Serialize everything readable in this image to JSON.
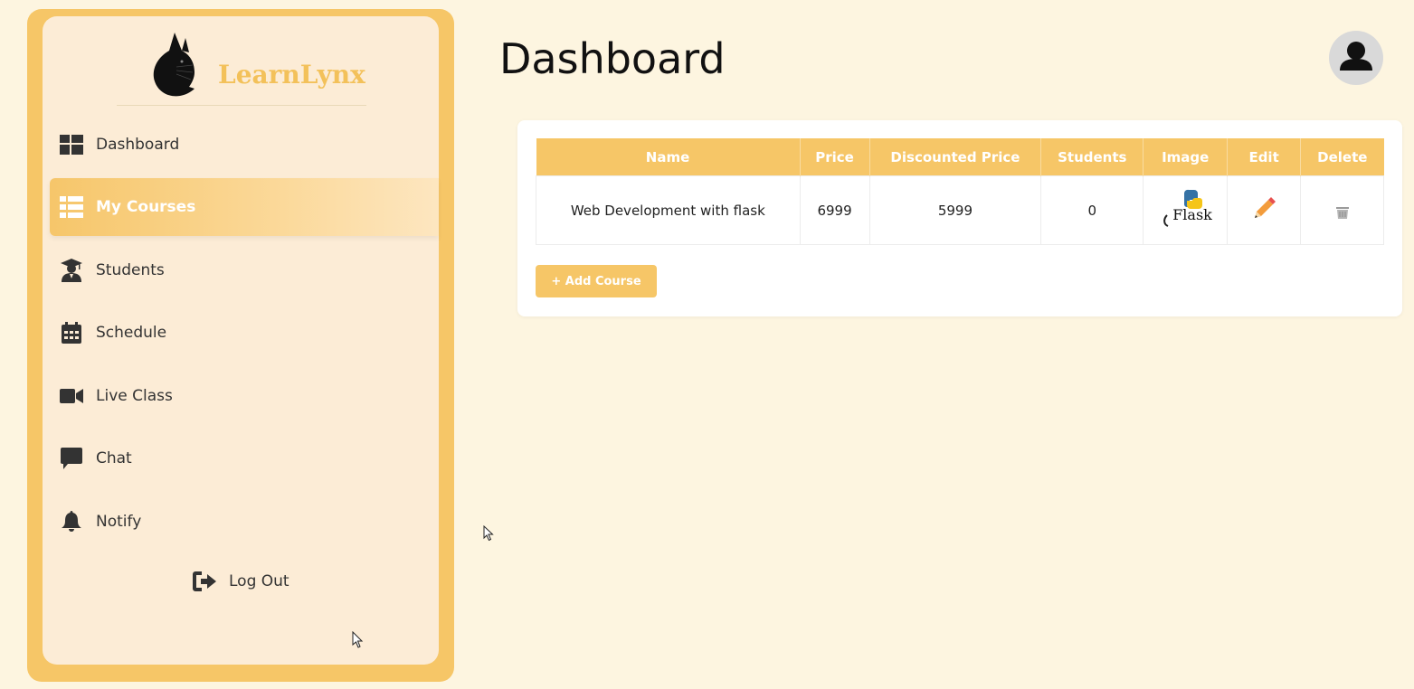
{
  "app": {
    "name": "LearnLynx",
    "accent_color": "#f6c667"
  },
  "sidebar": {
    "items": [
      {
        "label": "Dashboard",
        "icon": "dashboard-grid-icon",
        "active": false
      },
      {
        "label": "My Courses",
        "icon": "list-icon",
        "active": true
      },
      {
        "label": "Students",
        "icon": "graduate-icon",
        "active": false
      },
      {
        "label": "Schedule",
        "icon": "calendar-icon",
        "active": false
      },
      {
        "label": "Live Class",
        "icon": "video-camera-icon",
        "active": false
      },
      {
        "label": "Chat",
        "icon": "chat-bubble-icon",
        "active": false
      },
      {
        "label": "Notify",
        "icon": "bell-icon",
        "active": false
      }
    ],
    "logout_label": "Log Out"
  },
  "header": {
    "title": "Dashboard"
  },
  "courses_table": {
    "columns": [
      "Name",
      "Price",
      "Discounted Price",
      "Students",
      "Image",
      "Edit",
      "Delete"
    ],
    "rows": [
      {
        "name": "Web Development with flask",
        "price": "6999",
        "discounted_price": "5999",
        "students": "0",
        "image_caption": "Flask"
      }
    ]
  },
  "add_course_label": "+ Add Course"
}
